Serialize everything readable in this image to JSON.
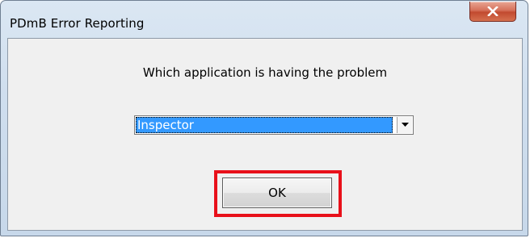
{
  "window": {
    "title": "PDmB Error Reporting",
    "close_icon": "close-icon"
  },
  "dialog": {
    "prompt": "Which application is having the problem",
    "application_select": {
      "selected": "Inspector"
    },
    "ok_label": "OK"
  },
  "colors": {
    "selection": "#3399ff",
    "highlight_box": "#e8101a",
    "close_button": "#c24a2f"
  }
}
